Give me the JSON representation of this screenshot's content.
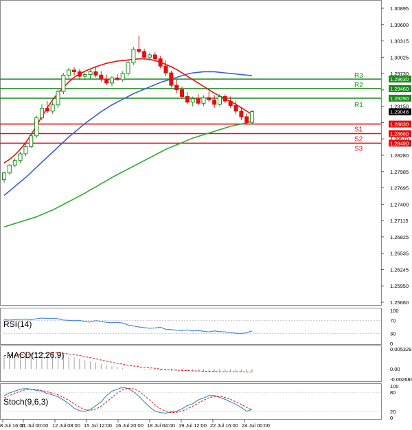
{
  "chart_data": {
    "type": "line",
    "main": {
      "ylim": [
        1.2566,
        1.3089
      ],
      "y_ticks": [
        "1.30895",
        "1.30600",
        "1.30315",
        "1.30025",
        "1.29730",
        "1.29440",
        "1.29150",
        "1.28860",
        "1.28570",
        "1.28280",
        "1.27985",
        "1.27695",
        "1.27400",
        "1.27115",
        "1.26825",
        "1.26535",
        "1.26245",
        "1.25950",
        "1.25660"
      ],
      "price_tags": [
        {
          "value": 1.2963,
          "label": "1.29630",
          "bg": "#1a8c1a"
        },
        {
          "value": 1.2946,
          "label": "1.29460",
          "bg": "#1a8c1a"
        },
        {
          "value": 1.2929,
          "label": "1.29290",
          "bg": "#1a8c1a"
        },
        {
          "value": 1.29048,
          "label": "1.29048",
          "bg": "#000000"
        },
        {
          "value": 1.2883,
          "label": "1.28830",
          "bg": "#e01010"
        },
        {
          "value": 1.2866,
          "label": "1.28660",
          "bg": "#e01010"
        },
        {
          "value": 1.2849,
          "label": "1.28490",
          "bg": "#e01010"
        }
      ],
      "levels": [
        {
          "name": "R3",
          "value": 1.2963,
          "color": "#1a8c1a"
        },
        {
          "name": "R2",
          "value": 1.2946,
          "color": "#1a8c1a"
        },
        {
          "name": "R1",
          "value": 1.2929,
          "color": "#1a8c1a"
        },
        {
          "name": "S1",
          "value": 1.2883,
          "color": "#e01010"
        },
        {
          "name": "S2",
          "value": 1.2866,
          "color": "#e01010"
        },
        {
          "name": "S3",
          "value": 1.2849,
          "color": "#e01010"
        }
      ],
      "candles": [
        [
          1.2784,
          1.2798,
          1.2779,
          1.2796
        ],
        [
          1.2796,
          1.2812,
          1.2793,
          1.281
        ],
        [
          1.281,
          1.2822,
          1.2806,
          1.2818
        ],
        [
          1.2818,
          1.2834,
          1.2814,
          1.283
        ],
        [
          1.283,
          1.2847,
          1.2826,
          1.2843
        ],
        [
          1.2843,
          1.2866,
          1.284,
          1.2862
        ],
        [
          1.2862,
          1.2898,
          1.2858,
          1.2894
        ],
        [
          1.2894,
          1.2918,
          1.289,
          1.2911
        ],
        [
          1.2911,
          1.2924,
          1.2902,
          1.2906
        ],
        [
          1.2906,
          1.2923,
          1.2901,
          1.2917
        ],
        [
          1.2917,
          1.2945,
          1.2912,
          1.2941
        ],
        [
          1.2941,
          1.2974,
          1.2936,
          1.297
        ],
        [
          1.297,
          1.2983,
          1.2965,
          1.2979
        ],
        [
          1.2979,
          1.2984,
          1.2969,
          1.2976
        ],
        [
          1.2976,
          1.2981,
          1.2962,
          1.2968
        ],
        [
          1.2968,
          1.2975,
          1.2961,
          1.2971
        ],
        [
          1.2971,
          1.298,
          1.2963,
          1.2976
        ],
        [
          1.2976,
          1.2984,
          1.2966,
          1.297
        ],
        [
          1.297,
          1.2977,
          1.2958,
          1.2963
        ],
        [
          1.2963,
          1.2971,
          1.2952,
          1.2956
        ],
        [
          1.2956,
          1.2968,
          1.295,
          1.2965
        ],
        [
          1.2965,
          1.2972,
          1.296,
          1.2962
        ],
        [
          1.2962,
          1.2977,
          1.2958,
          1.2973
        ],
        [
          1.2973,
          1.2996,
          1.2968,
          1.2992
        ],
        [
          1.2992,
          1.302,
          1.2988,
          1.3016
        ],
        [
          1.3016,
          1.304,
          1.3008,
          1.3012
        ],
        [
          1.3012,
          1.3017,
          1.2998,
          1.3002
        ],
        [
          1.3002,
          1.301,
          1.2996,
          1.3006
        ],
        [
          1.3006,
          1.3011,
          1.2994,
          1.2999
        ],
        [
          1.2999,
          1.3004,
          1.2982,
          1.2986
        ],
        [
          1.2986,
          1.2996,
          1.2968,
          1.2974
        ],
        [
          1.2974,
          1.2978,
          1.2948,
          1.2952
        ],
        [
          1.2952,
          1.2962,
          1.2938,
          1.2944
        ],
        [
          1.2944,
          1.295,
          1.2928,
          1.2932
        ],
        [
          1.2932,
          1.294,
          1.2918,
          1.2922
        ],
        [
          1.2922,
          1.2932,
          1.2914,
          1.2928
        ],
        [
          1.2928,
          1.2936,
          1.2916,
          1.292
        ],
        [
          1.292,
          1.2934,
          1.2915,
          1.293
        ],
        [
          1.293,
          1.2942,
          1.2922,
          1.2926
        ],
        [
          1.2926,
          1.2934,
          1.2912,
          1.2918
        ],
        [
          1.2918,
          1.2936,
          1.2914,
          1.2932
        ],
        [
          1.2932,
          1.2936,
          1.292,
          1.2924
        ],
        [
          1.2924,
          1.2932,
          1.2912,
          1.2916
        ],
        [
          1.2916,
          1.2924,
          1.29,
          1.2906
        ],
        [
          1.2906,
          1.2912,
          1.289,
          1.2896
        ],
        [
          1.2896,
          1.2902,
          1.2882,
          1.2886
        ],
        [
          1.2886,
          1.2908,
          1.2882,
          1.2905
        ]
      ],
      "ma_slow": [
        1.27,
        1.2703,
        1.2706,
        1.2709,
        1.2712,
        1.2715,
        1.2718,
        1.2722,
        1.2726,
        1.273,
        1.2735,
        1.274,
        1.2745,
        1.275,
        1.2755,
        1.276,
        1.2766,
        1.2771,
        1.2777,
        1.2782,
        1.2788,
        1.2793,
        1.2798,
        1.2803,
        1.2808,
        1.2813,
        1.2818,
        1.2823,
        1.2828,
        1.2833,
        1.2838,
        1.2842,
        1.2846,
        1.285,
        1.2854,
        1.2858,
        1.2861,
        1.2864,
        1.2867,
        1.287,
        1.2873,
        1.2876,
        1.2879,
        1.2881,
        1.2883,
        1.2885,
        1.2888
      ],
      "ma_mid": [
        1.2756,
        1.2764,
        1.2772,
        1.278,
        1.2788,
        1.2797,
        1.2806,
        1.2815,
        1.2824,
        1.2833,
        1.2842,
        1.2851,
        1.286,
        1.2868,
        1.2876,
        1.2884,
        1.2891,
        1.2898,
        1.2905,
        1.2911,
        1.2917,
        1.2922,
        1.2927,
        1.2932,
        1.2937,
        1.2941,
        1.2945,
        1.2949,
        1.2953,
        1.2957,
        1.296,
        1.2963,
        1.2966,
        1.2969,
        1.2972,
        1.2974,
        1.2975,
        1.2976,
        1.2976,
        1.2976,
        1.2975,
        1.2974,
        1.2973,
        1.2972,
        1.2971,
        1.297,
        1.2969
      ],
      "ma_fast": [
        1.2814,
        1.282,
        1.2828,
        1.2838,
        1.285,
        1.2864,
        1.288,
        1.2896,
        1.2912,
        1.2926,
        1.2938,
        1.2948,
        1.2958,
        1.2966,
        1.2972,
        1.2977,
        1.2981,
        1.2985,
        1.2988,
        1.2991,
        1.2993,
        1.2995,
        1.2996,
        1.2997,
        1.2998,
        1.2999,
        1.2999,
        1.2998,
        1.2996,
        1.2993,
        1.2989,
        1.2985,
        1.298,
        1.2974,
        1.2968,
        1.2962,
        1.2956,
        1.295,
        1.2944,
        1.2938,
        1.2933,
        1.2928,
        1.2923,
        1.2918,
        1.2912,
        1.2906,
        1.29
      ]
    },
    "rsi": {
      "label": "RSI(14)",
      "ylim": [
        0,
        100
      ],
      "y_ticks": [
        "100",
        "70",
        "30",
        "0"
      ],
      "values": [
        72,
        71,
        72,
        73,
        74,
        72,
        75,
        77,
        76,
        76,
        75,
        71,
        70,
        69,
        70,
        66,
        65,
        69,
        67,
        64,
        63,
        64,
        62,
        56,
        53,
        50,
        48,
        46,
        47,
        49,
        43,
        42,
        40,
        39,
        41,
        38,
        39,
        37,
        35,
        38,
        36,
        35,
        33,
        31,
        30,
        33,
        38
      ]
    },
    "macd": {
      "label": "MACD(12,26,9)",
      "y_ticks": [
        "0.005329",
        "0.00",
        "-0.002689"
      ],
      "histogram": [
        0.0036,
        0.0037,
        0.0038,
        0.0039,
        0.0041,
        0.0043,
        0.0044,
        0.0044,
        0.0044,
        0.0043,
        0.0041,
        0.0038,
        0.0034,
        0.0031,
        0.0027,
        0.0023,
        0.002,
        0.0017,
        0.0013,
        0.001,
        0.0007,
        0.0005,
        0.0003,
        0.0001,
        0.0,
        -0.0001,
        -0.0002,
        -0.0003,
        -0.0003,
        -0.0004,
        -0.0004,
        -0.0005,
        -0.0005,
        -0.0006,
        -0.0006,
        -0.0006,
        -0.0006,
        -0.0007,
        -0.0007,
        -0.0007,
        -0.0007,
        -0.0008,
        -0.0008,
        -0.0008,
        -0.0008,
        -0.0008,
        -0.0008
      ],
      "signal": [
        0.0036,
        0.0036,
        0.0037,
        0.0038,
        0.0039,
        0.004,
        0.0041,
        0.0042,
        0.0042,
        0.0043,
        0.0043,
        0.0042,
        0.004,
        0.0038,
        0.0036,
        0.0033,
        0.003,
        0.0027,
        0.0024,
        0.0021,
        0.0018,
        0.0015,
        0.0013,
        0.001,
        0.0008,
        0.0006,
        0.0004,
        0.0003,
        0.0002,
        0.0,
        -0.0001,
        -0.0002,
        -0.0003,
        -0.0004,
        -0.0004,
        -0.0005,
        -0.0005,
        -0.0006,
        -0.0006,
        -0.0006,
        -0.0007,
        -0.0007,
        -0.0007,
        -0.0007,
        -0.0007,
        -0.0008,
        -0.0008
      ]
    },
    "stoch": {
      "label": "Stoch(9,6,3)",
      "ylim": [
        0,
        100
      ],
      "y_ticks": [
        "100",
        "80",
        "20",
        "0"
      ],
      "main": [
        70,
        78,
        84,
        90,
        92,
        90,
        86,
        84,
        76,
        72,
        66,
        56,
        44,
        30,
        22,
        20,
        26,
        38,
        50,
        70,
        84,
        90,
        96,
        92,
        82,
        68,
        50,
        34,
        20,
        16,
        14,
        18,
        20,
        28,
        38,
        44,
        56,
        62,
        70,
        70,
        64,
        58,
        50,
        42,
        32,
        20,
        26
      ],
      "signal": [
        62,
        70,
        77,
        84,
        88,
        90,
        89,
        86,
        82,
        77,
        72,
        64,
        55,
        43,
        33,
        25,
        23,
        27,
        36,
        50,
        64,
        78,
        88,
        93,
        91,
        84,
        70,
        56,
        40,
        28,
        20,
        16,
        17,
        21,
        28,
        36,
        46,
        55,
        63,
        67,
        68,
        64,
        58,
        50,
        42,
        32,
        25
      ]
    },
    "x_ticks": [
      "8 Jul 16:00",
      "11 Jul 00:00",
      "12 Jul 08:00",
      "15 Jul 12:00",
      "16 Jul 20:00",
      "18 Jul 04:00",
      "19 Jul 12:00",
      "22 Jul 16:00",
      "24 Jul 00:00"
    ],
    "colors": {
      "up": "#1a8c1a",
      "down": "#e01010",
      "ma_fast": "#e01010",
      "ma_mid": "#3a5fcd",
      "ma_slow": "#2eaa2e",
      "rsi": "#4a86e8",
      "macd_signal": "#e01010",
      "stoch_main": "#3a86b8",
      "stoch_signal": "#e01010",
      "axis_text": "#000000",
      "level_text": "#1a8c1a"
    }
  }
}
